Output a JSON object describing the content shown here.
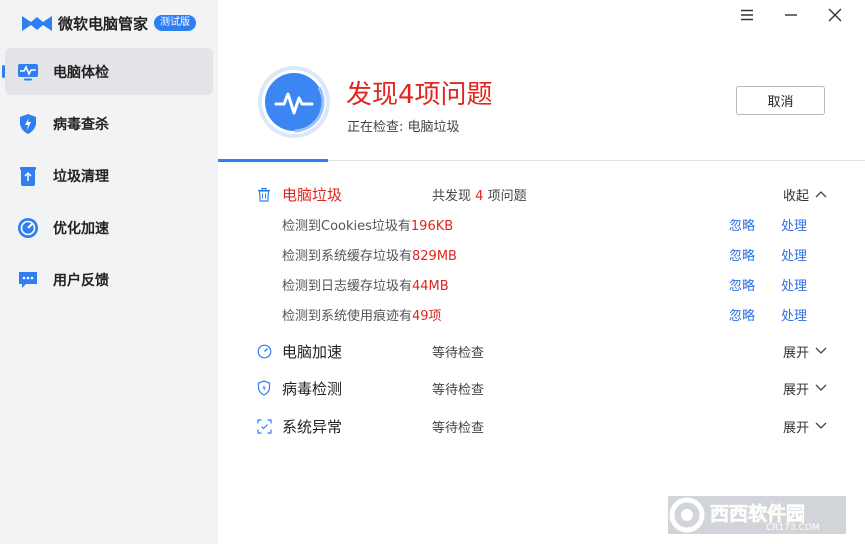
{
  "app": {
    "name": "微软电脑管家",
    "badge": "测试版"
  },
  "nav": [
    {
      "label": "电脑体检",
      "icon": "monitor-pulse-icon",
      "active": true
    },
    {
      "label": "病毒查杀",
      "icon": "shield-bolt-icon",
      "active": false
    },
    {
      "label": "垃圾清理",
      "icon": "trash-icon",
      "active": false
    },
    {
      "label": "优化加速",
      "icon": "speedometer-icon",
      "active": false
    },
    {
      "label": "用户反馈",
      "icon": "chat-bubble-icon",
      "active": false
    }
  ],
  "window": {
    "menu_icon": "menu-icon",
    "minimize_icon": "minimize-icon",
    "close_icon": "close-icon"
  },
  "header": {
    "title": "发现4项问题",
    "subtitle": "正在检查: 电脑垃圾",
    "cancel_label": "取消",
    "progress": 0.17
  },
  "sections": [
    {
      "title": "电脑垃圾",
      "status_prefix": "共发现",
      "status_count": "4",
      "status_suffix": "项问题",
      "toggle": "收起",
      "icon": "trash-outline-icon",
      "issues": [
        {
          "text": "检测到Cookies垃圾有",
          "value": "196KB",
          "ignore": "忽略",
          "handle": "处理"
        },
        {
          "text": "检测到系统缓存垃圾有",
          "value": "829MB",
          "ignore": "忽略",
          "handle": "处理"
        },
        {
          "text": "检测到日志缓存垃圾有",
          "value": "44MB",
          "ignore": "忽略",
          "handle": "处理"
        },
        {
          "text": "检测到系统使用痕迹有",
          "value": "49项",
          "ignore": "忽略",
          "handle": "处理"
        }
      ]
    },
    {
      "title": "电脑加速",
      "status": "等待检查",
      "toggle": "展开",
      "icon": "speed-gauge-icon"
    },
    {
      "title": "病毒检测",
      "status": "等待检查",
      "toggle": "展开",
      "icon": "shield-outline-icon"
    },
    {
      "title": "系统异常",
      "status": "等待检查",
      "toggle": "展开",
      "icon": "scan-frame-icon"
    }
  ],
  "watermark": {
    "text": "西西软件园",
    "url_text": "CR173.COM"
  },
  "colors": {
    "accent": "#2f7ff0",
    "alert": "#e0261f",
    "link": "#2f6fe6",
    "sidebar_bg": "#f2f3f5"
  }
}
